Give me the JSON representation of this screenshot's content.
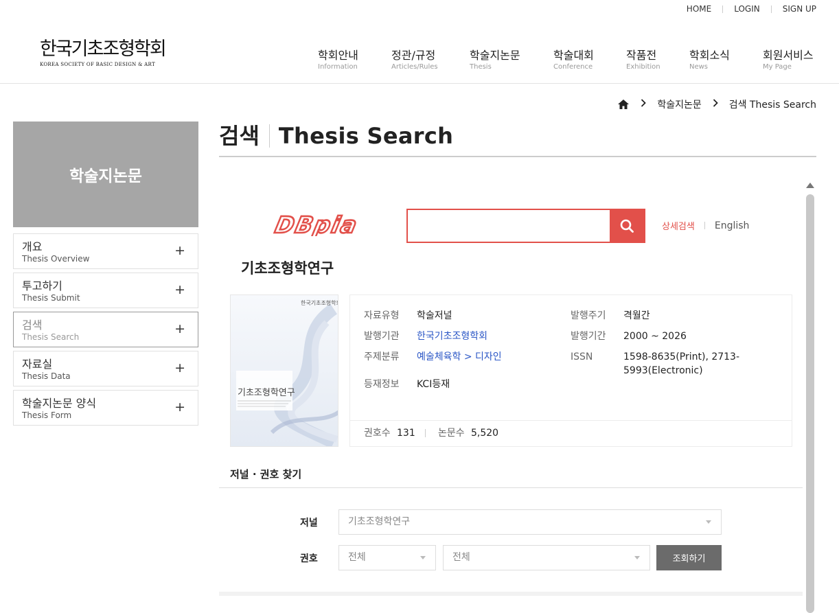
{
  "util_nav": [
    "HOME",
    "LOGIN",
    "SIGN UP"
  ],
  "logo": {
    "ko": "한국기초조형학회",
    "en": "KOREA SOCIETY OF BASIC DESIGN & ART"
  },
  "gnb": [
    {
      "ko": "학회안내",
      "en": "Information"
    },
    {
      "ko": "정관/규정",
      "en": "Articles/Rules"
    },
    {
      "ko": "학술지논문",
      "en": "Thesis"
    },
    {
      "ko": "학술대회",
      "en": "Conference"
    },
    {
      "ko": "작품전",
      "en": "Exhibition"
    },
    {
      "ko": "학회소식",
      "en": "News"
    },
    {
      "ko": "회원서비스",
      "en": "My Page"
    }
  ],
  "breadcrumb": {
    "level1": "학술지논문",
    "level2": "검색 Thesis Search"
  },
  "sidebar": {
    "title": "학술지논문",
    "items": [
      {
        "ko": "개요",
        "en": "Thesis Overview",
        "active": false
      },
      {
        "ko": "투고하기",
        "en": "Thesis Submit",
        "active": false
      },
      {
        "ko": "검색",
        "en": "Thesis Search",
        "active": true
      },
      {
        "ko": "자료실",
        "en": "Thesis Data",
        "active": false
      },
      {
        "ko": "학술지논문 양식",
        "en": "Thesis Form",
        "active": false
      }
    ],
    "plus": "+"
  },
  "page_title": {
    "ko": "검색",
    "en": "Thesis Search"
  },
  "dbpia": {
    "logo_text": "DBpia",
    "search_value": "",
    "advanced_label": "상세검색",
    "english_label": "English"
  },
  "journal": {
    "title": "기초조형학연구",
    "cover_title": "기초조형학연구",
    "cover_publisher": "한국기초조형학회",
    "info": {
      "type_label": "자료유형",
      "type_value": "학술저널",
      "publisher_label": "발행기관",
      "publisher_value": "한국기초조형학회",
      "subject_label": "주제분류",
      "subject_value": "예술체육학 > 디자인",
      "listing_label": "등재정보",
      "listing_value": "KCI등재",
      "cycle_label": "발행주기",
      "cycle_value": "격월간",
      "period_label": "발행기간",
      "period_value": "2000 ~ 2026",
      "issn_label": "ISSN",
      "issn_value_1": "1598-8635(Print), 2713-",
      "issn_value_2": "5993(Electronic)"
    },
    "stats": {
      "issues_label": "권호수",
      "issues_value": "131",
      "papers_label": "논문수",
      "papers_value": "5,520"
    }
  },
  "finder": {
    "title": "저널 · 권호 찾기",
    "journal_label": "저널",
    "journal_value": "기초조형학연구",
    "issue_label": "권호",
    "year_value": "전체",
    "volume_value": "전체",
    "query_button": "조회하기"
  },
  "colors": {
    "accent": "#e2504a",
    "link": "#2a56c6",
    "sidebar_head": "#a6a6a6"
  }
}
